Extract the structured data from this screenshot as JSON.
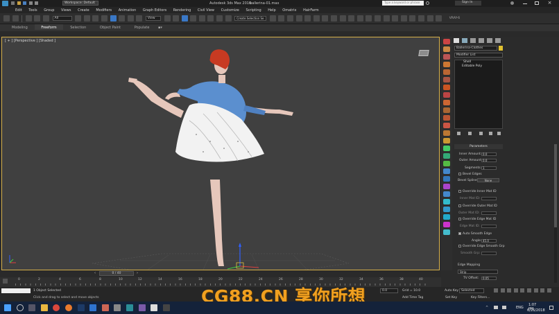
{
  "titlebar": {
    "workspace_label": "Workspace: Default",
    "app_title": "Autodesk 3ds Max 2016",
    "file_name": "ballerina-01.max",
    "search_placeholder": "Type a keyword or phrase",
    "sign_in": "Sign In"
  },
  "menu": [
    "Edit",
    "Tools",
    "Group",
    "Views",
    "Create",
    "Modifiers",
    "Animation",
    "Graph Editors",
    "Rendering",
    "Civil View",
    "Customize",
    "Scripting",
    "Help",
    "Omatrix",
    "HairFarm"
  ],
  "toolbar": {
    "selection_filter": "All",
    "ref_coord": "View",
    "named_selection": "Create Selection Se",
    "vray_label": "VRAY-6"
  },
  "ribbon": {
    "tabs": [
      "Modeling",
      "Freeform",
      "Selection",
      "Object Paint",
      "Populate"
    ],
    "active": "Freeform"
  },
  "viewport": {
    "label": "[ + ] [Perspective ] [Shaded ]"
  },
  "command_panel": {
    "object_name": "Ballerina-Clothes",
    "modifier_list": "Modifier List",
    "stack": [
      "Shell",
      "Editable Poly"
    ],
    "rollout_title": "Parameters",
    "params": [
      {
        "label": "Inner Amount:",
        "value": "0.0"
      },
      {
        "label": "Outer Amount:",
        "value": "0.0"
      },
      {
        "label": "Segments:",
        "value": "1"
      }
    ],
    "bevel_edges": "Bevel Edges",
    "bevel_spline_label": "Bevel Spline:",
    "bevel_spline_value": "None",
    "override_inner": "Override Inner Mat ID",
    "inner_mat_id": "Inner Mat ID:",
    "override_outer": "Override Outer Mat ID",
    "outer_mat_id": "Outer Mat ID:",
    "override_edge": "Override Edge Mat ID",
    "edge_mat_id": "Edge Mat ID:",
    "auto_smooth": "Auto Smooth Edge",
    "angle_label": "Angle:",
    "angle_value": "45.0",
    "override_edge_smooth": "Override Edge Smooth Grp",
    "smooth_grp": "Smooth Grp:",
    "edge_mapping": "Edge Mapping",
    "edge_mapping_value": "Strip",
    "tv_offset_label": "TV Offset:",
    "tv_offset_value": "0.05"
  },
  "timeline": {
    "frame_label": "0 / 40",
    "ticks": [
      "0",
      "2",
      "4",
      "6",
      "8",
      "10",
      "12",
      "14",
      "16",
      "18",
      "20",
      "22",
      "24",
      "26",
      "28",
      "30",
      "32",
      "34",
      "36",
      "38",
      "40"
    ]
  },
  "status": {
    "selected": "1 Object Selected",
    "prompt": "Click and drag to select and move objects",
    "coord_value": "0.0",
    "grid": "Grid = 10.0",
    "add_time_tag": "Add Time Tag",
    "auto_key": "Auto Key",
    "auto_key_value": "Selected",
    "set_key": "Set Key",
    "key_filters": "Key Filters..."
  },
  "taskbar": {
    "language": "ENG",
    "time": "1:07 PM",
    "date": "6/26/2018"
  },
  "watermark": "CG88.CN 享你所想"
}
